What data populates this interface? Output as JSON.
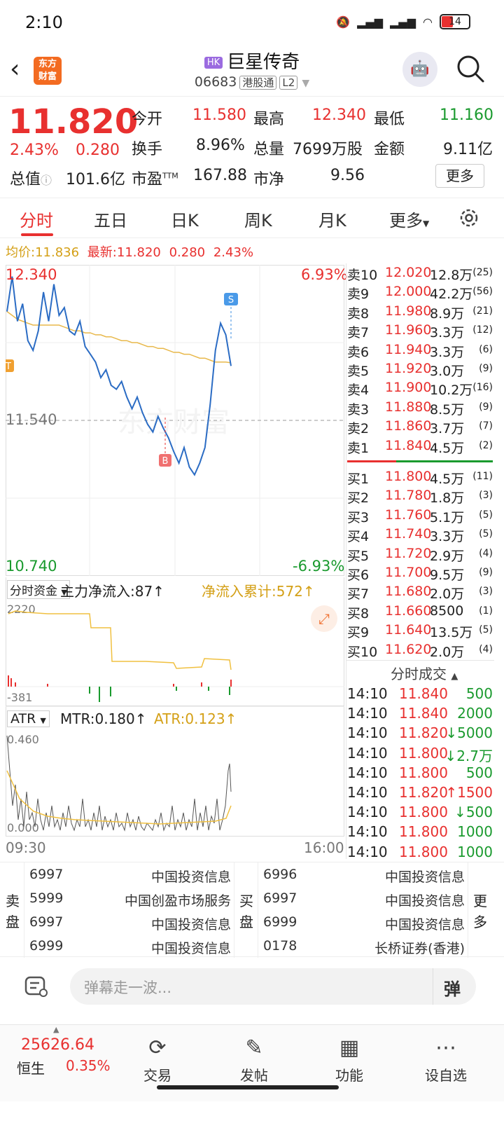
{
  "status_bar": {
    "time": "2:10",
    "battery": "14"
  },
  "header": {
    "market_badge": "HK",
    "stock_name": "巨星传奇",
    "stock_code": "06683",
    "tag1": "港股通",
    "tag2": "L2",
    "logo_text_1": "东方",
    "logo_text_2": "财富"
  },
  "quote": {
    "price": "11.820",
    "change_pct": "2.43%",
    "change": "0.280",
    "open_label": "今开",
    "open": "11.580",
    "high_label": "最高",
    "high": "12.340",
    "low_label": "最低",
    "low": "11.160",
    "turnover_label": "换手",
    "turnover": "8.96%",
    "volume_label": "总量",
    "volume": "7699万股",
    "amount_label": "金额",
    "amount": "9.11亿",
    "mcap_label": "总值",
    "mcap": "101.6亿",
    "pe_label": "市盈",
    "pe_sup": "TTM",
    "pe": "167.88",
    "pb_label": "市净",
    "pb": "9.56",
    "more_label": "更多"
  },
  "tabs": [
    "分时",
    "五日",
    "日K",
    "周K",
    "月K",
    "更多"
  ],
  "info_line": {
    "avg_label": "均价:",
    "avg": "11.836",
    "latest_label": "最新:",
    "latest": "11.820",
    "chg": "0.280",
    "pct": "2.43%"
  },
  "chart": {
    "top_price": "12.340",
    "top_pct": "6.93%",
    "mid_price": "11.540",
    "bottom_price": "10.740",
    "bottom_pct": "-6.93%",
    "watermark": "东方财富",
    "marker_t": "T",
    "marker_b": "B",
    "marker_s": "S"
  },
  "capital": {
    "selector": "分时资金",
    "main_label": "主力净流入:87↑",
    "cum_label": "净流入累计:572↑",
    "top": "2220",
    "bottom": "-381"
  },
  "atr": {
    "selector": "ATR",
    "mtr": "MTR:0.180↑",
    "atr": "ATR:0.123↑",
    "top": "0.460",
    "bottom": "0.000",
    "time_start": "09:30",
    "time_end": "16:00"
  },
  "chart_data": {
    "type": "line",
    "price_series": [
      12.1,
      12.28,
      12.05,
      12.14,
      11.95,
      11.9,
      12.0,
      12.2,
      12.05,
      12.24,
      12.08,
      12.12,
      12.0,
      11.98,
      12.05,
      11.92,
      11.88,
      11.84,
      11.76,
      11.8,
      11.72,
      11.7,
      11.74,
      11.66,
      11.6,
      11.66,
      11.58,
      11.52,
      11.48,
      11.56,
      11.5,
      11.45,
      11.38,
      11.32,
      11.4,
      11.3,
      11.26,
      11.32,
      11.4,
      11.62,
      11.9,
      12.04,
      11.98,
      11.82
    ],
    "avg_series": [
      12.1,
      12.08,
      12.06,
      12.05,
      12.04,
      12.03,
      12.03,
      12.03,
      12.03,
      12.03,
      12.03,
      12.02,
      12.01,
      12.0,
      12.0,
      11.99,
      11.99,
      11.98,
      11.98,
      11.97,
      11.97,
      11.96,
      11.95,
      11.95,
      11.94,
      11.94,
      11.93,
      11.92,
      11.92,
      11.91,
      11.91,
      11.9,
      11.89,
      11.89,
      11.88,
      11.88,
      11.87,
      11.86,
      11.86,
      11.85,
      11.84,
      11.84,
      11.84,
      11.836
    ],
    "ylim": [
      10.74,
      12.34
    ]
  },
  "order_book": {
    "asks": [
      {
        "label": "卖10",
        "price": "12.020",
        "vol": "12.8万",
        "cnt": "(25)"
      },
      {
        "label": "卖9",
        "price": "12.000",
        "vol": "42.2万",
        "cnt": "(56)"
      },
      {
        "label": "卖8",
        "price": "11.980",
        "vol": "8.9万",
        "cnt": "(21)"
      },
      {
        "label": "卖7",
        "price": "11.960",
        "vol": "3.3万",
        "cnt": "(12)"
      },
      {
        "label": "卖6",
        "price": "11.940",
        "vol": "3.3万",
        "cnt": "(6)"
      },
      {
        "label": "卖5",
        "price": "11.920",
        "vol": "3.0万",
        "cnt": "(9)"
      },
      {
        "label": "卖4",
        "price": "11.900",
        "vol": "10.2万",
        "cnt": "(16)"
      },
      {
        "label": "卖3",
        "price": "11.880",
        "vol": "8.5万",
        "cnt": "(9)"
      },
      {
        "label": "卖2",
        "price": "11.860",
        "vol": "3.7万",
        "cnt": "(7)"
      },
      {
        "label": "卖1",
        "price": "11.840",
        "vol": "4.5万",
        "cnt": "(2)"
      }
    ],
    "bids": [
      {
        "label": "买1",
        "price": "11.800",
        "vol": "4.5万",
        "cnt": "(11)"
      },
      {
        "label": "买2",
        "price": "11.780",
        "vol": "1.8万",
        "cnt": "(3)"
      },
      {
        "label": "买3",
        "price": "11.760",
        "vol": "5.1万",
        "cnt": "(5)"
      },
      {
        "label": "买4",
        "price": "11.740",
        "vol": "3.3万",
        "cnt": "(5)"
      },
      {
        "label": "买5",
        "price": "11.720",
        "vol": "2.9万",
        "cnt": "(4)"
      },
      {
        "label": "买6",
        "price": "11.700",
        "vol": "9.5万",
        "cnt": "(9)"
      },
      {
        "label": "买7",
        "price": "11.680",
        "vol": "2.0万",
        "cnt": "(3)"
      },
      {
        "label": "买8",
        "price": "11.660",
        "vol": "8500",
        "cnt": "(1)"
      },
      {
        "label": "买9",
        "price": "11.640",
        "vol": "13.5万",
        "cnt": "(5)"
      },
      {
        "label": "买10",
        "price": "11.620",
        "vol": "2.0万",
        "cnt": "(4)"
      }
    ]
  },
  "trades_title": "分时成交",
  "trades": [
    {
      "time": "14:10",
      "price": "11.840",
      "arrow": "",
      "vol": "500"
    },
    {
      "time": "14:10",
      "price": "11.840",
      "arrow": "",
      "vol": "2000"
    },
    {
      "time": "14:10",
      "price": "11.820",
      "arrow": "↓",
      "vol": "5000"
    },
    {
      "time": "14:10",
      "price": "11.800",
      "arrow": "↓",
      "vol": "2.7万"
    },
    {
      "time": "14:10",
      "price": "11.800",
      "arrow": "",
      "vol": "500"
    },
    {
      "time": "14:10",
      "price": "11.820",
      "arrow": "↑",
      "vol": "1500"
    },
    {
      "time": "14:10",
      "price": "11.800",
      "arrow": "↓",
      "vol": "500"
    },
    {
      "time": "14:10",
      "price": "11.800",
      "arrow": "",
      "vol": "1000"
    },
    {
      "time": "14:10",
      "price": "11.800",
      "arrow": "",
      "vol": "1000"
    }
  ],
  "brokers": {
    "sell_label": "卖盘",
    "buy_label": "买盘",
    "more_label": "更多",
    "sell": [
      {
        "id": "6997",
        "name": "中国投资信息"
      },
      {
        "id": "5999",
        "name": "中国创盈市场服务"
      },
      {
        "id": "6997",
        "name": "中国投资信息"
      },
      {
        "id": "6999",
        "name": "中国投资信息"
      }
    ],
    "buy": [
      {
        "id": "6996",
        "name": "中国投资信息"
      },
      {
        "id": "6997",
        "name": "中国投资信息"
      },
      {
        "id": "6999",
        "name": "中国投资信息"
      },
      {
        "id": "0178",
        "name": "长桥证券(香港)"
      }
    ]
  },
  "comment": {
    "placeholder": "弹幕走一波...",
    "danmu_label": "弹"
  },
  "bottom": {
    "index_value": "25626.64",
    "index_name": "恒生",
    "index_pct": "0.35%",
    "nav": [
      "交易",
      "发帖",
      "功能",
      "设自选"
    ]
  }
}
